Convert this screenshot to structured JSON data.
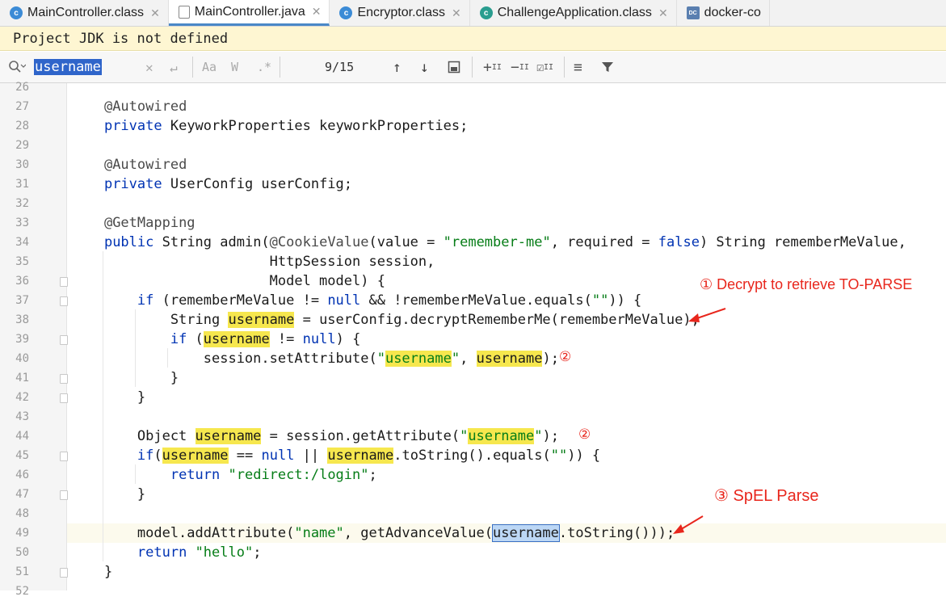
{
  "tabs": [
    {
      "label": "MainController.class",
      "icon": "class-icon"
    },
    {
      "label": "MainController.java",
      "icon": "java-file-icon",
      "active": true
    },
    {
      "label": "Encryptor.class",
      "icon": "class-icon"
    },
    {
      "label": "ChallengeApplication.class",
      "icon": "app-class-icon"
    },
    {
      "label": "docker-co",
      "icon": "docker-compose-icon"
    }
  ],
  "notice": "Project JDK is not defined",
  "find": {
    "query": "username",
    "count": "9/15",
    "match_case": "Aa",
    "words": "W",
    "regex": ".*"
  },
  "code_lines": [
    {
      "n": "26",
      "t": ""
    },
    {
      "n": "27",
      "t": "    @Autowired"
    },
    {
      "n": "28",
      "t": "    private KeyworkProperties keyworkProperties;"
    },
    {
      "n": "29",
      "t": ""
    },
    {
      "n": "30",
      "t": "    @Autowired"
    },
    {
      "n": "31",
      "t": "    private UserConfig userConfig;"
    },
    {
      "n": "32",
      "t": ""
    },
    {
      "n": "33",
      "t": "    @GetMapping"
    },
    {
      "n": "34",
      "t": "    public String admin(@CookieValue(value = \"remember-me\", required = false) String rememberMeValue,"
    },
    {
      "n": "35",
      "t": "                        HttpSession session,"
    },
    {
      "n": "36",
      "t": "                        Model model) {"
    },
    {
      "n": "37",
      "t": "        if (rememberMeValue != null && !rememberMeValue.equals(\"\")) {"
    },
    {
      "n": "38",
      "t": "            String username = userConfig.decryptRememberMe(rememberMeValue);"
    },
    {
      "n": "39",
      "t": "            if (username != null) {"
    },
    {
      "n": "40",
      "t": "                session.setAttribute(\"username\", username);"
    },
    {
      "n": "41",
      "t": "            }"
    },
    {
      "n": "42",
      "t": "        }"
    },
    {
      "n": "43",
      "t": ""
    },
    {
      "n": "44",
      "t": "        Object username = session.getAttribute(\"username\");"
    },
    {
      "n": "45",
      "t": "        if(username == null || username.toString().equals(\"\")) {"
    },
    {
      "n": "46",
      "t": "            return \"redirect:/login\";"
    },
    {
      "n": "47",
      "t": "        }"
    },
    {
      "n": "48",
      "t": ""
    },
    {
      "n": "49",
      "t": "        model.addAttribute(\"name\", getAdvanceValue(username.toString()));"
    },
    {
      "n": "50",
      "t": "        return \"hello\";"
    },
    {
      "n": "51",
      "t": "    }"
    },
    {
      "n": "52",
      "t": ""
    }
  ],
  "annotations": {
    "note1": "① Decrypt to retrieve TO-PARSE",
    "note2a": "②",
    "note2b": "②",
    "note3": "③ SpEL Parse"
  },
  "colors": {
    "keyword": "#0033b3",
    "string": "#067d17",
    "highlight": "#f6e74e",
    "annotation_red": "#e8261c",
    "selection": "#bcd7f5"
  }
}
